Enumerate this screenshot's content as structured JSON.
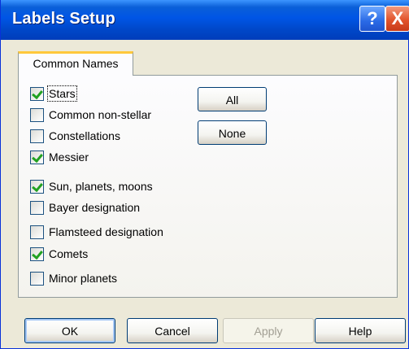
{
  "window": {
    "title": "Labels Setup"
  },
  "titlebar_buttons": {
    "help": "?",
    "close": "X"
  },
  "tab": {
    "label": "Common Names"
  },
  "checkboxes": [
    {
      "label": "Stars",
      "checked": true
    },
    {
      "label": "Common non-stellar",
      "checked": false
    },
    {
      "label": "Constellations",
      "checked": false
    },
    {
      "label": "Messier",
      "checked": true
    },
    {
      "label": "Sun, planets, moons",
      "checked": true
    },
    {
      "label": "Bayer designation",
      "checked": false
    },
    {
      "label": "Flamsteed designation",
      "checked": false
    },
    {
      "label": "Comets",
      "checked": true
    },
    {
      "label": "Minor planets",
      "checked": false
    }
  ],
  "side_buttons": {
    "all": "All",
    "none": "None"
  },
  "bottom_buttons": {
    "ok": "OK",
    "cancel": "Cancel",
    "apply": "Apply",
    "help": "Help"
  }
}
